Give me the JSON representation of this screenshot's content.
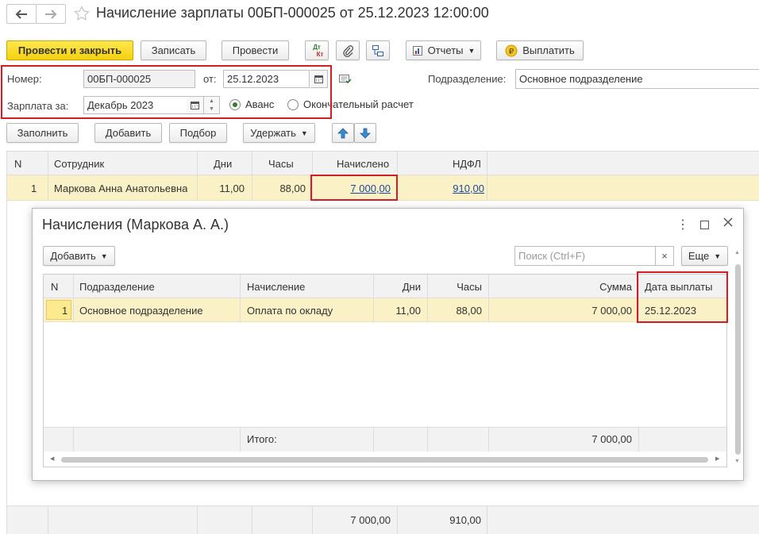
{
  "window": {
    "title": "Начисление зарплаты 00БП-000025 от 25.12.2023 12:00:00",
    "back_symbol": "🡐",
    "forward_symbol": "🡒"
  },
  "toolbar": {
    "post_close": "Провести и закрыть",
    "save": "Записать",
    "post": "Провести",
    "dt_kt_top": "Дт",
    "dt_kt_bottom": "Кт",
    "reports": "Отчеты",
    "pay": "Выплатить"
  },
  "header": {
    "number_label": "Номер:",
    "number_value": "00БП-000025",
    "from_label": "от:",
    "date_value": "25.12.2023",
    "department_label": "Подразделение:",
    "department_value": "Основное подразделение",
    "salary_for_label": "Зарплата за:",
    "salary_for_value": "Декабрь 2023",
    "radio_advance": "Аванс",
    "radio_final": "Окончательный расчет",
    "radio_selected": "Аванс"
  },
  "table_toolbar": {
    "fill": "Заполнить",
    "add": "Добавить",
    "select": "Подбор",
    "withhold": "Удержать"
  },
  "main_table": {
    "columns": [
      "N",
      "Сотрудник",
      "Дни",
      "Часы",
      "Начислено",
      "НДФЛ"
    ],
    "rows": [
      {
        "n": "1",
        "employee": "Маркова Анна Анатольевна",
        "days": "11,00",
        "hours": "88,00",
        "accrued": "7 000,00",
        "ndfl": "910,00"
      }
    ],
    "totals": {
      "accrued": "7 000,00",
      "ndfl": "910,00"
    }
  },
  "modal": {
    "title": "Начисления (Маркова А. А.)",
    "add": "Добавить",
    "search_placeholder": "Поиск (Ctrl+F)",
    "search_clear": "×",
    "more": "Еще",
    "columns": [
      "N",
      "Подразделение",
      "Начисление",
      "Дни",
      "Часы",
      "Сумма",
      "Дата выплаты"
    ],
    "rows": [
      {
        "n": "1",
        "department": "Основное подразделение",
        "accrual": "Оплата по окладу",
        "days": "11,00",
        "hours": "88,00",
        "sum": "7 000,00",
        "pay_date": "25.12.2023"
      }
    ],
    "totals_label": "Итого:",
    "totals_sum": "7 000,00"
  },
  "colors": {
    "primary_button": "#f5d10f",
    "highlight_row": "#fbf1c7",
    "red_annotation": "#d21d24",
    "link": "#1c4a9a"
  }
}
